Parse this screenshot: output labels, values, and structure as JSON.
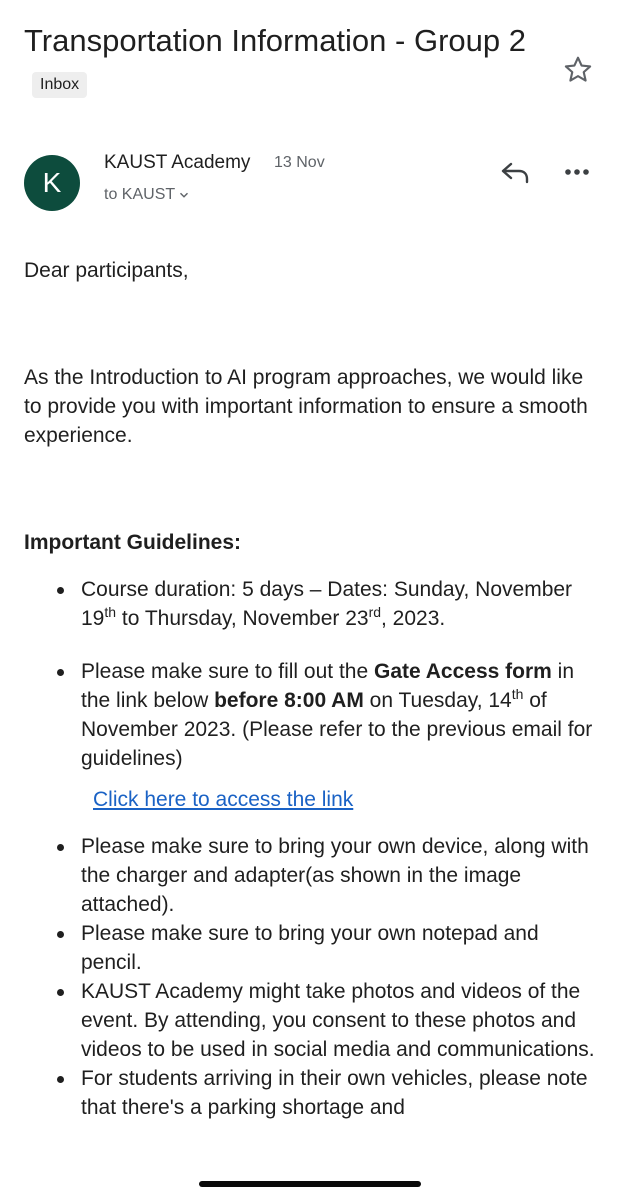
{
  "email": {
    "subject": "Transportation Information - Group 2",
    "label": "Inbox",
    "avatar_letter": "K",
    "sender": "KAUST Academy",
    "date": "13 Nov",
    "recipient": "to KAUST",
    "icons": {
      "star": "star-outline-icon",
      "reply": "reply-icon",
      "more": "more-horizontal-icon",
      "chevron": "chevron-down-icon"
    },
    "colors": {
      "avatar": "#0d4c3d",
      "link": "#1a62c5"
    }
  },
  "body": {
    "greeting": "Dear participants,",
    "intro": "As the Introduction to AI program approaches, we would like to provide you with important information to ensure a smooth experience.",
    "heading": "Important Guidelines:",
    "item1": {
      "a": "Course duration: 5 days – Dates: Sunday, November 19",
      "sup1": "th",
      "b": " to Thursday, November 23",
      "sup2": "rd",
      "c": ", 2023."
    },
    "item2": {
      "a": "Please make sure to fill out the ",
      "b_bold": "Gate Access form",
      "c": " in the link below ",
      "d_bold": "before 8:00 AM",
      "e": " on Tuesday, 14",
      "sup": "th",
      "f": " of November 2023. (Please refer to the previous email for guidelines)"
    },
    "link": "Click here to access the link",
    "item3": "Please make sure to bring your own device, along with the charger and adapter(as shown in the image attached).",
    "item4": "Please make sure to bring your own notepad and pencil.",
    "item5": "KAUST Academy might take photos and videos of the event. By attending, you consent to these photos and videos to be used in social media and communications.",
    "item6": "For students arriving in their own vehicles, please note that there's a parking shortage and"
  }
}
